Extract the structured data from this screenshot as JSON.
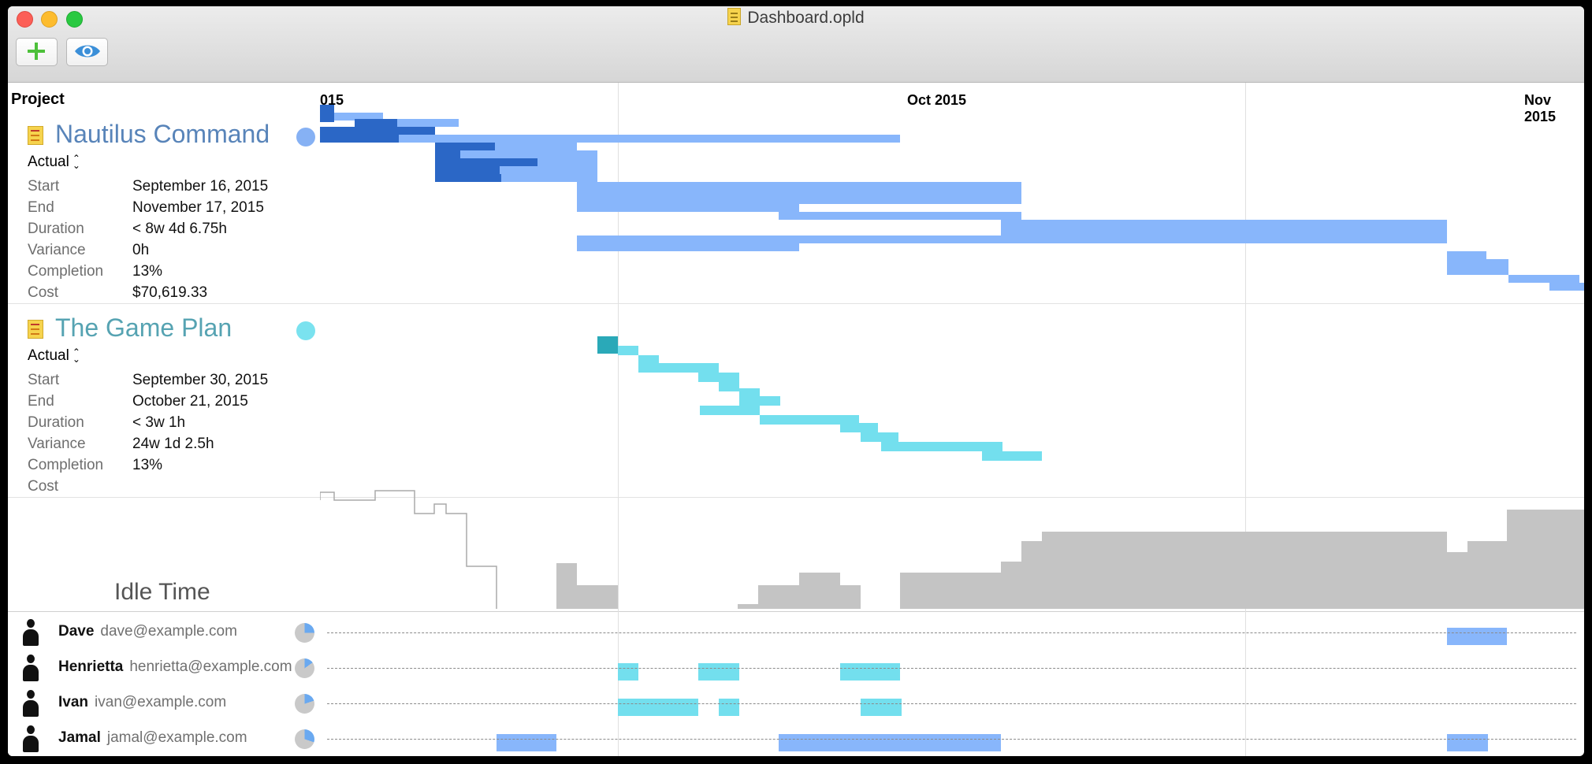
{
  "window": {
    "title": "Dashboard.opld"
  },
  "toolbar": {
    "add_icon": "plus-icon",
    "view_icon": "eye-icon",
    "accent_add": "#4dc03a",
    "accent_view": "#3b8fd8"
  },
  "outline": {
    "header": "Project"
  },
  "timeline": {
    "months": [
      "015",
      "Oct 2015",
      "Nov 2015"
    ]
  },
  "projects": [
    {
      "name": "Nautilus Command",
      "color": "#86b1f4",
      "mode": "Actual",
      "fields": [
        {
          "label": "Start",
          "value": "September 16, 2015"
        },
        {
          "label": "End",
          "value": "November 17, 2015"
        },
        {
          "label": "Duration",
          "value": "< 8w 4d 6.75h"
        },
        {
          "label": "Variance",
          "value": "0h"
        },
        {
          "label": "Completion",
          "value": "13%"
        },
        {
          "label": "Cost",
          "value": "$70,619.33"
        }
      ]
    },
    {
      "name": "The Game Plan",
      "color": "#7ae2ef",
      "mode": "Actual",
      "fields": [
        {
          "label": "Start",
          "value": "September 30, 2015"
        },
        {
          "label": "End",
          "value": "October 21, 2015"
        },
        {
          "label": "Duration",
          "value": "< 3w 1h"
        },
        {
          "label": "Variance",
          "value": "24w 1d 2.5h"
        },
        {
          "label": "Completion",
          "value": "13%"
        },
        {
          "label": "Cost",
          "value": ""
        }
      ]
    }
  ],
  "idle": {
    "label": "Idle Time"
  },
  "resources": [
    {
      "name": "Dave",
      "email": "dave@example.com",
      "utilization": 0.25
    },
    {
      "name": "Henrietta",
      "email": "henrietta@example.com",
      "utilization": 0.15
    },
    {
      "name": "Ivan",
      "email": "ivan@example.com",
      "utilization": 0.2
    },
    {
      "name": "Jamal",
      "email": "jamal@example.com",
      "utilization": 0.3
    }
  ]
}
